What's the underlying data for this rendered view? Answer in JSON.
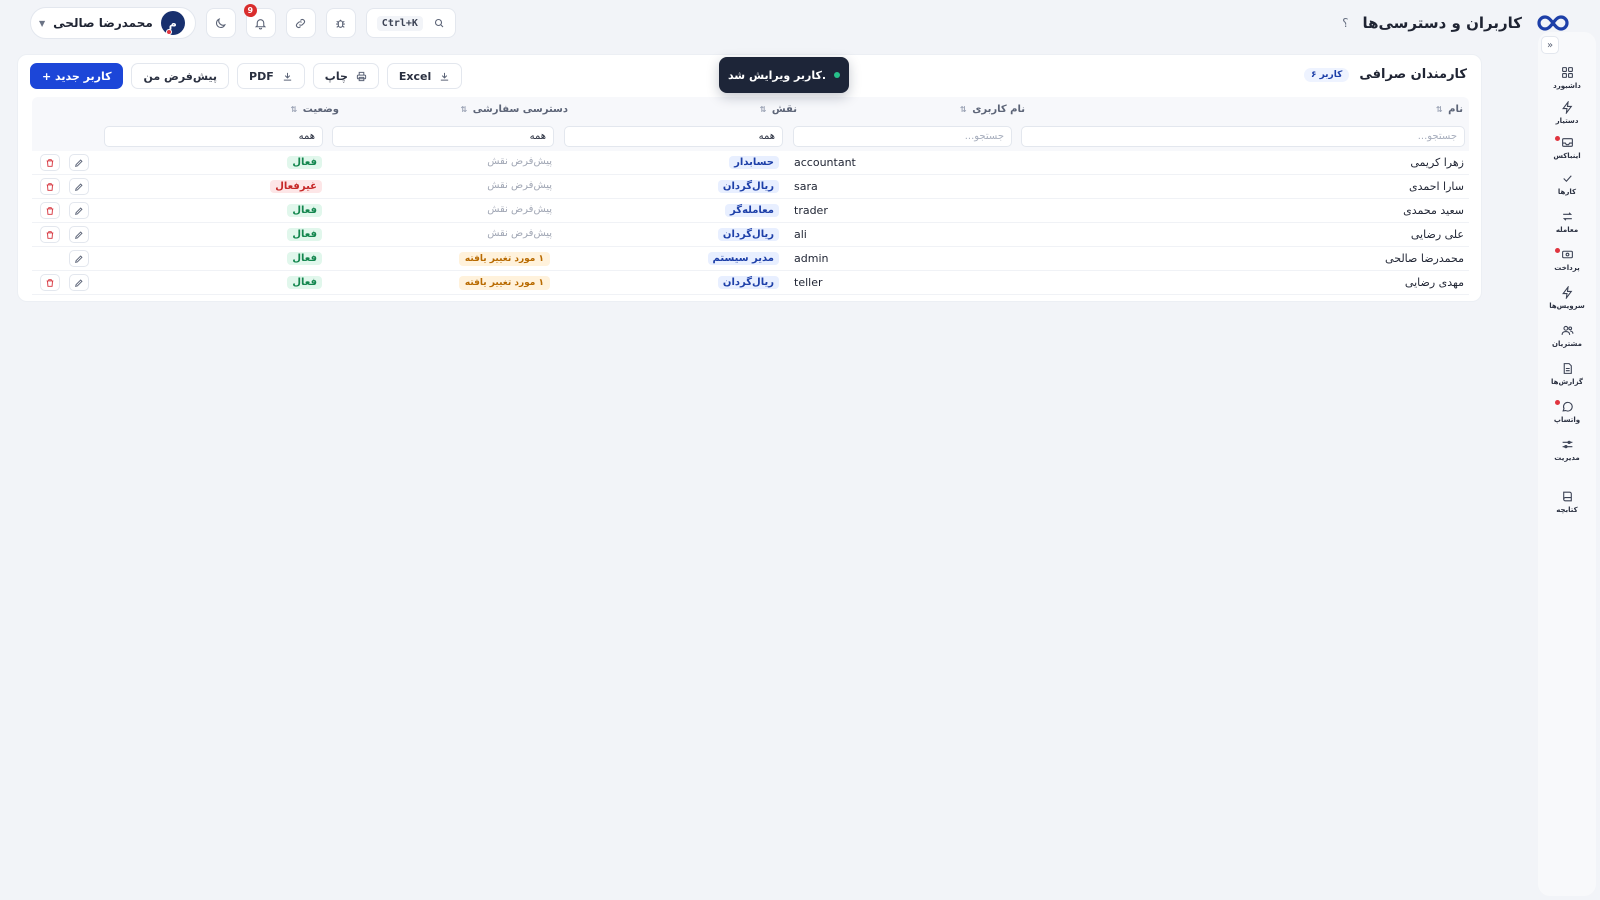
{
  "header": {
    "title": "کاربران و دسترسی‌ها",
    "help_label": "؟",
    "user_name": "محمدرضا صالحی",
    "user_initial": "م",
    "notification_count": "9",
    "search_shortcut": "Ctrl+K"
  },
  "sidebar": {
    "items": [
      {
        "label": "داشبورد",
        "icon": "grid-icon"
      },
      {
        "label": "دستیار",
        "icon": "bolt-icon"
      },
      {
        "label": "اینباکس",
        "icon": "inbox-icon"
      },
      {
        "label": "کارها",
        "icon": "check-icon"
      },
      {
        "label": "معامله",
        "icon": "swap-icon"
      },
      {
        "label": "پرداخت",
        "icon": "cash-icon"
      },
      {
        "label": "سرویس‌ها",
        "icon": "flash-icon"
      },
      {
        "label": "مشتریان",
        "icon": "users-icon"
      },
      {
        "label": "گزارش‌ها",
        "icon": "report-icon"
      },
      {
        "label": "واتساپ",
        "icon": "chat-icon"
      },
      {
        "label": "مدیریت",
        "icon": "sliders-icon"
      },
      {
        "label": "کتابچه",
        "icon": "book-icon"
      }
    ]
  },
  "card": {
    "title": "کارمندان صرافی",
    "count_badge": "۶ کاربر",
    "toolbar": {
      "new_user": "+ کاربر جدید",
      "my_default": "پیش‌فرض من",
      "pdf": "PDF",
      "print": "چاپ",
      "excel": "Excel"
    }
  },
  "toast": {
    "message": "کاربر ویرایش شد."
  },
  "table": {
    "headers": {
      "name": "نام",
      "username": "نام کاربری",
      "role": "نقش",
      "custom_access": "دسترسی سفارشی",
      "status": "وضعیت"
    },
    "filters": {
      "name_placeholder": "جستجو...",
      "username_placeholder": "جستجو...",
      "role": "همه",
      "custom_access": "همه",
      "status": "همه"
    },
    "rows": [
      {
        "name": "زهرا کریمی",
        "username": "accountant",
        "role": "حسابدار",
        "access": "پیش‌فرض نقش",
        "status": "فعال"
      },
      {
        "name": "سارا احمدی",
        "username": "sara",
        "role": "ریال‌گردان",
        "access": "پیش‌فرض نقش",
        "status": "غیرفعال"
      },
      {
        "name": "سعید محمدی",
        "username": "trader",
        "role": "معامله‌گر",
        "access": "پیش‌فرض نقش",
        "status": "فعال"
      },
      {
        "name": "علی رضایی",
        "username": "ali",
        "role": "ریال‌گردان",
        "access": "پیش‌فرض نقش",
        "status": "فعال"
      },
      {
        "name": "محمدرضا صالحی",
        "username": "admin",
        "role": "مدیر سیستم",
        "access": "۱ مورد تغییر یافته",
        "status": "فعال"
      },
      {
        "name": "مهدی رضایی",
        "username": "teller",
        "role": "ریال‌گردان",
        "access": "۱ مورد تغییر یافته",
        "status": "فعال"
      }
    ]
  },
  "colors": {
    "primary": "#1c46d8",
    "active_green": "#13864e",
    "inactive_red": "#c62828",
    "toast_bg": "#1d2538"
  }
}
